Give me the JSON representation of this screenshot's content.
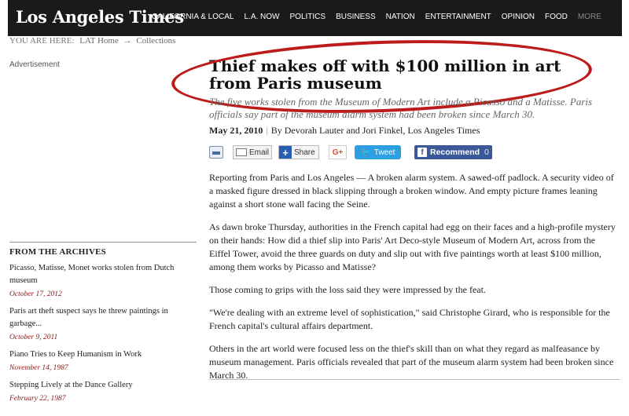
{
  "header": {
    "logo": "Los Angeles Times",
    "nav": [
      "CALIFORNIA & LOCAL",
      "L.A. NOW",
      "POLITICS",
      "BUSINESS",
      "NATION",
      "ENTERTAINMENT",
      "OPINION",
      "FOOD",
      "MORE"
    ]
  },
  "breadcrumb": {
    "label": "YOU ARE HERE:",
    "home": "LAT Home",
    "arrow": "→",
    "section": "Collections"
  },
  "sidebar": {
    "advertisement": "Advertisement",
    "archives_title": "FROM THE ARCHIVES",
    "archives": [
      {
        "title": "Picasso, Matisse, Monet works stolen from Dutch museum",
        "date": "October 17, 2012"
      },
      {
        "title": "Paris art theft suspect says he threw paintings in garbage...",
        "date": "October 9, 2011"
      },
      {
        "title": "Piano Tries to Keep Humanism in Work",
        "date": "November 14, 1987"
      },
      {
        "title": "Stepping Lively at the Dance Gallery",
        "date": "February 22, 1987"
      }
    ]
  },
  "article": {
    "headline": "Thief makes off with $100 million in art from Paris museum",
    "dek": "The five works stolen from the Museum of Modern Art include a Picasso and a Matisse. Paris officials say part of the museum alarm system had been broken since March 30.",
    "date": "May 21, 2010",
    "pipe": "|",
    "byline": "By Devorah Lauter and Jori Finkel, Los Angeles Times",
    "paragraphs": [
      "Reporting from Paris and Los Angeles — A broken alarm system. A sawed-off padlock. A security video of a masked figure dressed in black slipping through a broken window. And empty picture frames leaning against a short stone wall facing the Seine.",
      "As dawn broke Thursday, authorities in the French capital had egg on their faces and a high-profile mystery on their hands: How did a thief slip into Paris' Art Deco-style Museum of Modern Art, across from the Eiffel Tower, avoid the three guards on duty and slip out with five paintings worth at least $100 million, among them works by Picasso and Matisse?",
      "Those coming to grips with the loss said they were impressed by the feat.",
      "\"We're dealing with an extreme level of sophistication,\" said Christophe Girard, who is responsible for the French capital's cultural affairs department.",
      "Others in the art world were focused less on the thief's skill than on what they regard as malfeasance by museum management. Paris officials revealed that part of the museum alarm system had been broken since March 30."
    ]
  },
  "share": {
    "email": "Email",
    "share": "Share",
    "gplus": "G+",
    "tweet": "Tweet",
    "recommend": "Recommend",
    "recommend_count": "0"
  },
  "colors": {
    "nav_bg": "#1a1a1a",
    "highlight_circle": "#bd1a1a",
    "archive_date": "#8b1a1a",
    "facebook": "#3b5998",
    "twitter": "#2b9fe0"
  }
}
